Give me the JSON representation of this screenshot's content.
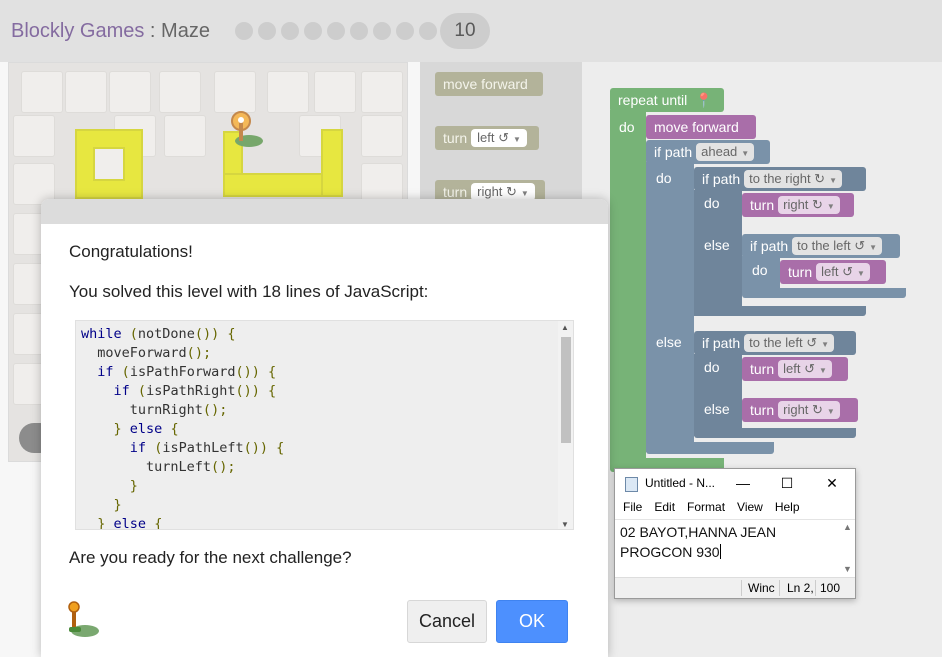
{
  "header": {
    "app_name": "Blockly Games",
    "separator": " : ",
    "game_name": "Maze",
    "current_level": "10"
  },
  "toolbox": {
    "move_forward": "move forward",
    "turn_left_label": "turn",
    "turn_left_value": "left ↺",
    "turn_right_label": "turn",
    "turn_right_value": "right ↻"
  },
  "workspace": {
    "repeat_until": "repeat until",
    "do": "do",
    "move_forward": "move forward",
    "if_path": "if path",
    "ahead": "ahead",
    "to_the_right": "to the right ↻",
    "to_the_left": "to the left ↺",
    "turn": "turn",
    "right": "right ↻",
    "left": "left ↺",
    "else": "else"
  },
  "dialog": {
    "congrats": "Congratulations!",
    "solved": "You solved this level with 18 lines of JavaScript:",
    "code_lines": [
      "while (notDone()) {",
      "  moveForward();",
      "  if (isPathForward()) {",
      "    if (isPathRight()) {",
      "      turnRight();",
      "    } else {",
      "      if (isPathLeft()) {",
      "        turnLeft();",
      "      }",
      "    }",
      "  } else {"
    ],
    "next_question": "Are you ready for the next challenge?",
    "cancel_label": "Cancel",
    "ok_label": "OK"
  },
  "notepad": {
    "title": "Untitled - N...",
    "minimize": "—",
    "maximize": "☐",
    "close": "✕",
    "menu": [
      "File",
      "Edit",
      "Format",
      "View",
      "Help"
    ],
    "line1": "02 BAYOT,HANNA JEAN",
    "line2": "PROGCON 930",
    "status_encoding": "Winc",
    "status_position": "Ln 2,",
    "status_zoom": "100"
  },
  "colors": {
    "accent_blue": "#4d90fe",
    "brand_purple": "#5b3a80",
    "maze_path_yellow": "#dfdf00"
  }
}
